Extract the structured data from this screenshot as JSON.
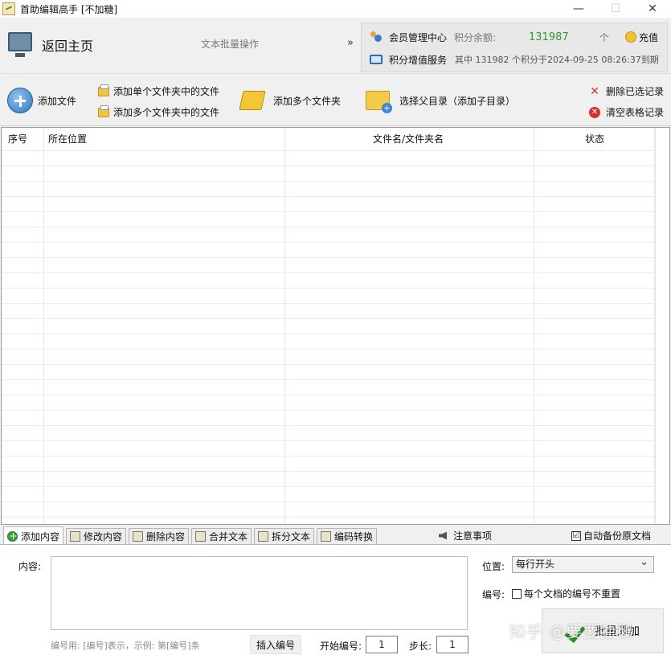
{
  "window": {
    "title": "首助编辑高手 [不加糖]",
    "controls": {
      "minimize": "—",
      "maximize": "☐",
      "close": "✕"
    }
  },
  "header": {
    "home_label": "返回主页",
    "subtitle": "文本批量操作",
    "chevron": "»",
    "member": {
      "center_label": "会员管理中心",
      "balance_label": "积分余额:",
      "balance_value": "131987",
      "balance_unit": "个",
      "recharge_label": "充值",
      "points_service_label": "积分增值服务",
      "points_info": "其中 131982 个积分于2024-09-25 08:26:37到期"
    }
  },
  "toolbar": {
    "add_file": "添加文件",
    "add_single_folder_files": "添加单个文件夹中的文件",
    "add_multi_folder_files": "添加多个文件夹中的文件",
    "add_multi_folders": "添加多个文件夹",
    "select_parent_dir": "选择父目录（添加子目录）",
    "delete_selected": "删除已选记录",
    "clear_table": "清空表格记录"
  },
  "table": {
    "columns": [
      "序号",
      "所在位置",
      "文件名/文件夹名",
      "状态"
    ],
    "rows": []
  },
  "tabs": {
    "items": [
      "添加内容",
      "修改内容",
      "删除内容",
      "合并文本",
      "拆分文本",
      "编码转换"
    ],
    "active": "添加内容",
    "notice_label": "注意事项",
    "auto_backup_label": "自动备份原文档",
    "auto_backup_checked": "☑"
  },
  "form": {
    "content_label": "内容:",
    "content_value": "",
    "position_label": "位置:",
    "position_value": "每行开头",
    "number_label": "编号:",
    "no_reset_label": "每个文档的编号不重置",
    "hint": "编号用: [编号]表示，示例: 第[编号]条",
    "insert_number_button": "插入编号",
    "start_number_label": "开始编号:",
    "start_number_value": "1",
    "step_label": "步长:",
    "step_value": "1",
    "run_button": "批量添加"
  },
  "watermark": "知乎 @要要独鹅"
}
